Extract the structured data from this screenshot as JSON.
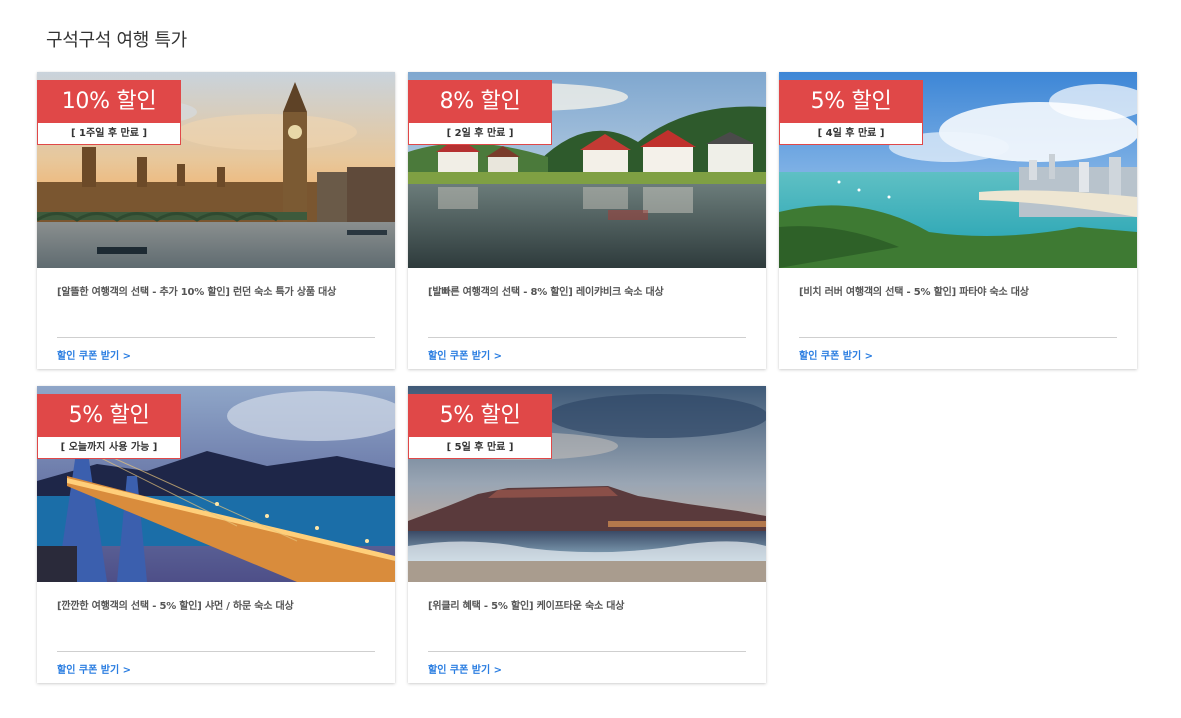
{
  "section_title": "구석구석 여행 특가",
  "cards": [
    {
      "discount": "10% 할인",
      "expiry": "[ 1주일 후 만료 ]",
      "description": "[알뜰한 여행객의 선택 - 추가 10% 할인] 런던 숙소 특가 상품 대상",
      "link": "할인 쿠폰 받기 >",
      "image": "london-big-ben-image"
    },
    {
      "discount": "8% 할인",
      "expiry": "[ 2일 후 만료 ]",
      "description": "[발빠른 여행객의 선택 - 8% 할인] 레이캬비크 숙소 대상",
      "link": "할인 쿠폰 받기 >",
      "image": "reykjavik-lake-houses-image"
    },
    {
      "discount": "5% 할인",
      "expiry": "[ 4일 후 만료 ]",
      "description": "[비치 러버 여행객의 선택 - 5% 할인] 파타야 숙소 대상",
      "link": "할인 쿠폰 받기 >",
      "image": "pattaya-bay-image"
    },
    {
      "discount": "5% 할인",
      "expiry": "[ 오늘까지 사용 가능 ]",
      "description": "[깐깐한 여행객의 선택 - 5% 할인] 샤먼 / 하문 숙소 대상",
      "link": "할인 쿠폰 받기 >",
      "image": "xiamen-bridge-image"
    },
    {
      "discount": "5% 할인",
      "expiry": "[ 5일 후 만료 ]",
      "description": "[위클리 혜택 - 5% 할인] 케이프타운 숙소 대상",
      "link": "할인 쿠폰 받기 >",
      "image": "cape-town-table-mountain-image"
    }
  ],
  "colors": {
    "badge": "#e04848",
    "link": "#2a7de1"
  }
}
